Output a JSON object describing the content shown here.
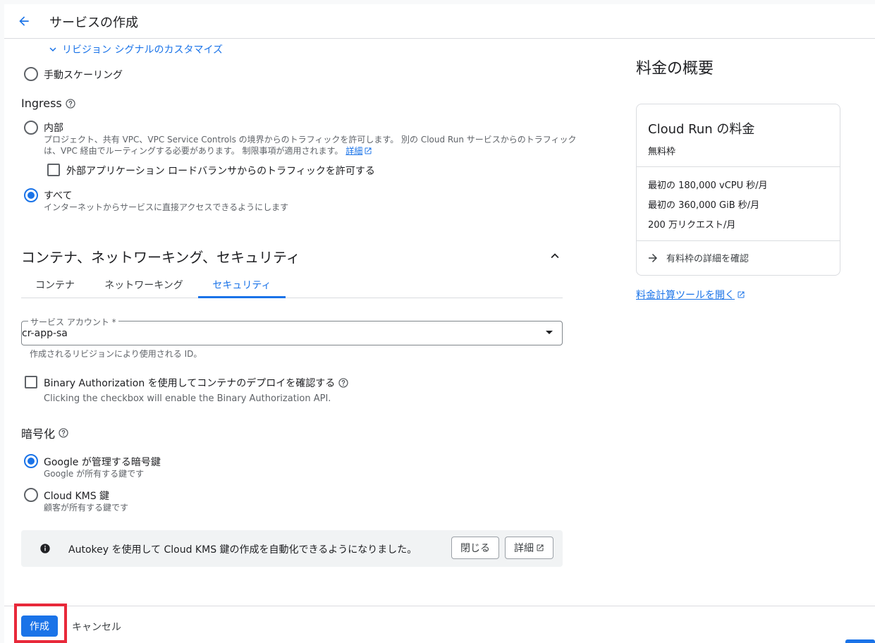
{
  "header": {
    "title": "サービスの作成"
  },
  "revision_signals": {
    "label": "リビジョン シグナルのカスタマイズ"
  },
  "scaling": {
    "manual_label": "手動スケーリング"
  },
  "ingress": {
    "heading": "Ingress",
    "internal": {
      "label": "内部",
      "desc_line1": "プロジェクト、共有 VPC、VPC Service Controls の境界からのトラフィックを許可します。 別の Cloud Run サービスからのトラフィック",
      "desc_line2": "は、VPC 経由でルーティングする必要があります。 制限事項が適用されます。",
      "link": "詳細",
      "external_lb_label": "外部アプリケーション ロードバランサからのトラフィックを許可する"
    },
    "all": {
      "label": "すべて",
      "desc": "インターネットからサービスに直接アクセスできるようにします"
    }
  },
  "container_section": {
    "heading": "コンテナ、ネットワーキング、セキュリティ",
    "tabs": [
      {
        "label": "コンテナ"
      },
      {
        "label": "ネットワーキング"
      },
      {
        "label": "セキュリティ"
      }
    ]
  },
  "service_account": {
    "label": "サービス アカウント *",
    "value": "cr-app-sa",
    "hint": "作成されるリビジョンにより使用される ID。"
  },
  "binary_auth": {
    "label": "Binary Authorization を使用してコンテナのデプロイを確認する",
    "desc": "Clicking the checkbox will enable the Binary Authorization API."
  },
  "encryption": {
    "heading": "暗号化",
    "google": {
      "label": "Google が管理する暗号鍵",
      "desc": "Google が所有する鍵です"
    },
    "kms": {
      "label": "Cloud KMS 鍵",
      "desc": "顧客が所有する鍵です"
    }
  },
  "banner": {
    "text": "Autokey を使用して Cloud KMS 鍵の作成を自動化できるようになりました。",
    "close_label": "閉じる",
    "details_label": "詳細"
  },
  "pricing": {
    "heading": "料金の概要",
    "card_title": "Cloud Run の料金",
    "card_subtitle": "無料枠",
    "items": [
      "最初の 180,000 vCPU 秒/月",
      "最初の 360,000 GiB 秒/月",
      "200 万リクエスト/月"
    ],
    "details_link": "有料枠の詳細を確認",
    "calculator_link": "料金計算ツールを開く"
  },
  "footer": {
    "create_label": "作成",
    "cancel_label": "キャンセル"
  },
  "colors": {
    "accent": "#1a73e8",
    "highlight": "#e8293a"
  }
}
